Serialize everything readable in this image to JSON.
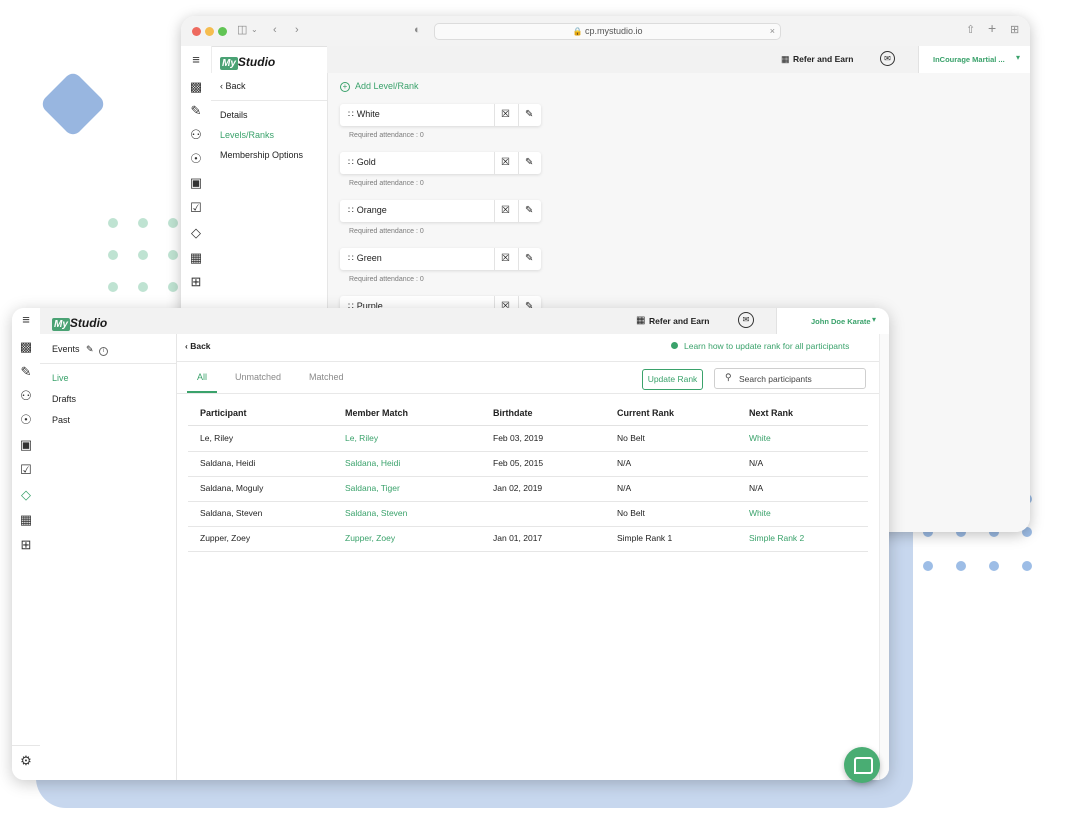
{
  "colors": {
    "accent": "#3aa26b",
    "accent_dark": "#2f8a5a",
    "deco_blue": "#9dbde6",
    "deco_green": "#bfe3d2"
  },
  "browser": {
    "url": "cp.mystudio.io",
    "lock_icon": "lock-icon",
    "close_icon": "close-icon"
  },
  "back_window": {
    "logo_box": "My",
    "logo_text": "Studio",
    "header": {
      "refer_label": "Refer and Earn",
      "studio_name": "InCourage Martial ...",
      "icons": [
        "gift-icon",
        "mail-icon",
        "chevron-down-icon"
      ]
    },
    "rail_icons": [
      "menu-collapse-icon",
      "analytics-icon",
      "pen-icon",
      "people-icon",
      "megaphone-icon",
      "calendar-settings-icon",
      "clipboard-icon",
      "tag-icon",
      "store-icon",
      "apps-add-icon"
    ],
    "sidebar": {
      "back_label": "Back",
      "items": [
        {
          "label": "Details",
          "active": false
        },
        {
          "label": "Levels/Ranks",
          "active": true
        },
        {
          "label": "Membership Options",
          "active": false
        }
      ]
    },
    "main": {
      "add_label": "Add Level/Rank",
      "ranks": [
        {
          "name": "White",
          "req": "Required attendance : 0"
        },
        {
          "name": "Gold",
          "req": "Required attendance : 0"
        },
        {
          "name": "Orange",
          "req": "Required attendance : 0"
        },
        {
          "name": "Green",
          "req": "Required attendance : 0"
        },
        {
          "name": "Purple",
          "req": ""
        }
      ]
    }
  },
  "front_window": {
    "logo_box": "My",
    "logo_text": "Studio",
    "header": {
      "refer_label": "Refer and Earn",
      "studio_name": "John Doe Karate"
    },
    "rail_icons": [
      "menu-collapse-icon",
      "analytics-icon",
      "pen-icon",
      "people-icon",
      "megaphone-icon",
      "calendar-settings-icon",
      "clipboard-icon",
      "tag-icon",
      "store-icon",
      "apps-add-icon",
      "settings-icon"
    ],
    "sidebar": {
      "title": "Events",
      "items": [
        {
          "label": "Live",
          "active": true
        },
        {
          "label": "Drafts",
          "active": false
        },
        {
          "label": "Past",
          "active": false
        }
      ]
    },
    "main": {
      "back_label": "Back",
      "learn_link": "Learn how to update rank for all participants",
      "tabs": [
        {
          "label": "All",
          "active": true
        },
        {
          "label": "Unmatched",
          "active": false
        },
        {
          "label": "Matched",
          "active": false
        }
      ],
      "update_button": "Update Rank",
      "search_placeholder": "Search participants",
      "columns": [
        "Participant",
        "Member Match",
        "Birthdate",
        "Current Rank",
        "Next Rank"
      ],
      "rows": [
        {
          "participant": "Le, Riley",
          "member": "Le, Riley",
          "birthdate": "Feb 03, 2019",
          "current": "No Belt",
          "next": "White",
          "next_link": true
        },
        {
          "participant": "Saldana, Heidi",
          "member": "Saldana, Heidi",
          "birthdate": "Feb 05, 2015",
          "current": "N/A",
          "next": "N/A",
          "next_link": false
        },
        {
          "participant": "Saldana, Moguly",
          "member": "Saldana, Tiger",
          "birthdate": "Jan 02, 2019",
          "current": "N/A",
          "next": "N/A",
          "next_link": false
        },
        {
          "participant": "Saldana, Steven",
          "member": "Saldana, Steven",
          "birthdate": "",
          "current": "No Belt",
          "next": "White",
          "next_link": true
        },
        {
          "participant": "Zupper, Zoey",
          "member": "Zupper, Zoey",
          "birthdate": "Jan 01, 2017",
          "current": "Simple Rank 1",
          "next": "Simple Rank 2",
          "next_link": true
        }
      ]
    },
    "chat_icon": "chat-icon"
  }
}
